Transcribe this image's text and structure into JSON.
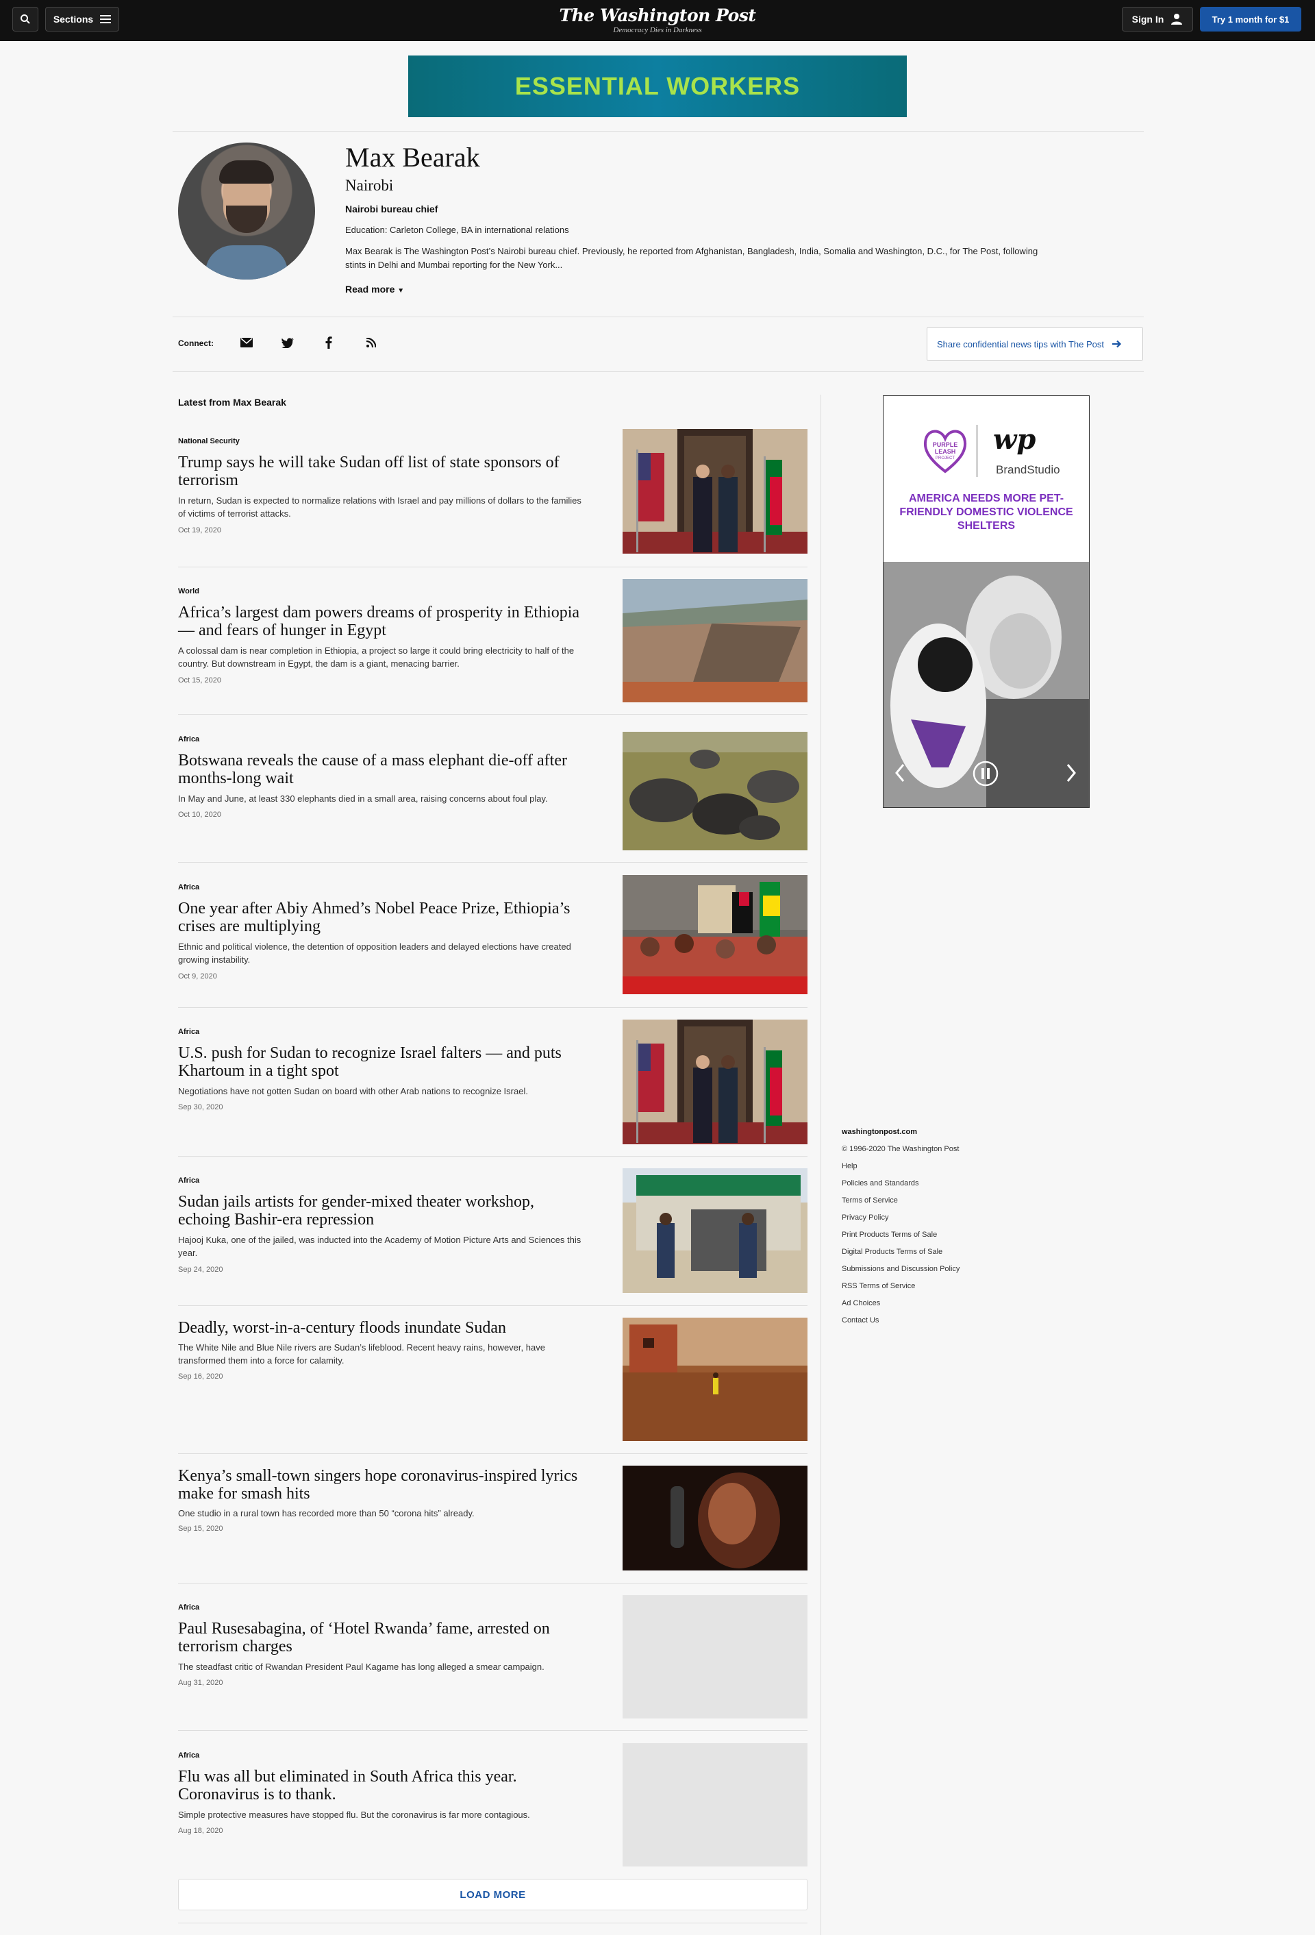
{
  "nav": {
    "sections_label": "Sections",
    "logo": "The Washington Post",
    "tagline": "Democracy Dies in Darkness",
    "signin_label": "Sign In",
    "subscribe_label": "Try 1 month for $1"
  },
  "top_ad": {
    "text": "ESSENTIAL WORKERS"
  },
  "author": {
    "name": "Max Bearak",
    "location": "Nairobi",
    "title": "Nairobi bureau chief",
    "education": "Education: Carleton College, BA in international relations",
    "bio": "Max Bearak is The Washington Post’s Nairobi bureau chief. Previously, he reported from Afghanistan, Bangladesh, India, Somalia and Washington, D.C., for The Post, following stints in Delhi and Mumbai reporting for the New York...",
    "read_more": "Read more"
  },
  "connect": {
    "label": "Connect:",
    "icons": [
      "email-icon",
      "twitter-icon",
      "facebook-icon",
      "rss-icon"
    ],
    "tips_label": "Share confidential news tips with The Post"
  },
  "latest_label": "Latest from Max Bearak",
  "articles": [
    {
      "kicker": "National Security",
      "headline": "Trump says he will take Sudan off list of state sponsors of terrorism",
      "blurb": "In return, Sudan is expected to normalize relations with Israel and pay millions of dollars to the families of victims of terrorist attacks.",
      "date": "Oct 19, 2020"
    },
    {
      "kicker": "World",
      "headline": "Africa’s largest dam powers dreams of prosperity in Ethiopia — and fears of hunger in Egypt",
      "blurb": "A colossal dam is near completion in Ethiopia, a project so large it could bring electricity to half of the country. But downstream in Egypt, the dam is a giant, menacing barrier.",
      "date": "Oct 15, 2020"
    },
    {
      "kicker": "Africa",
      "headline": "Botswana reveals the cause of a mass elephant die-off after months-long wait",
      "blurb": "In May and June, at least 330 elephants died in a small area, raising concerns about foul play.",
      "date": "Oct 10, 2020"
    },
    {
      "kicker": "Africa",
      "headline": "One year after Abiy Ahmed’s Nobel Peace Prize, Ethiopia’s crises are multiplying",
      "blurb": "Ethnic and political violence, the detention of opposition leaders and delayed elections have created growing instability.",
      "date": "Oct 9, 2020"
    },
    {
      "kicker": "Africa",
      "headline": "U.S. push for Sudan to recognize Israel falters — and puts Khartoum in a tight spot",
      "blurb": "Negotiations have not gotten Sudan on board with other Arab nations to recognize Israel.",
      "date": "Sep 30, 2020"
    },
    {
      "kicker": "Africa",
      "headline": "Sudan jails artists for gender-mixed theater workshop, echoing Bashir-era repression",
      "blurb": "Hajooj Kuka, one of the jailed, was inducted into the Academy of Motion Picture Arts and Sciences this year.",
      "date": "Sep 24, 2020"
    },
    {
      "kicker": "",
      "headline": "Deadly, worst-in-a-century floods inundate Sudan",
      "blurb": "The White Nile and Blue Nile rivers are Sudan’s lifeblood. Recent heavy rains, however, have transformed them into a force for calamity.",
      "date": "Sep 16, 2020"
    },
    {
      "kicker": "",
      "headline": "Kenya’s small-town singers hope coronavirus-inspired lyrics make for smash hits",
      "blurb": "One studio in a rural town has recorded more than 50 “corona hits” already.",
      "date": "Sep 15, 2020"
    },
    {
      "kicker": "Africa",
      "headline": "Paul Rusesabagina, of ‘Hotel Rwanda’ fame, arrested on terrorism charges",
      "blurb": "The steadfast critic of Rwandan President Paul Kagame has long alleged a smear campaign.",
      "date": "Aug 31, 2020"
    },
    {
      "kicker": "Africa",
      "headline": "Flu was all but eliminated in South Africa this year. Coronavirus is to thank.",
      "blurb": "Simple protective measures have stopped flu. But the coronavirus is far more contagious.",
      "date": "Aug 18, 2020"
    }
  ],
  "load_more": "LOAD MORE",
  "side_ad": {
    "brand": "BrandStudio",
    "headline": "AMERICA NEEDS MORE PET-FRIENDLY DOMESTIC VIOLENCE SHELTERS",
    "wp_mark": "wp",
    "partner_logo_text": "PURPLE LEASH PROJECT"
  },
  "footer": {
    "domain": "washingtonpost.com",
    "copyright": "© 1996-2020 The Washington Post",
    "links": [
      "Help",
      "Policies and Standards",
      "Terms of Service",
      "Privacy Policy",
      "Print Products Terms of Sale",
      "Digital Products Terms of Sale",
      "Submissions and Discussion Policy",
      "RSS Terms of Service",
      "Ad Choices",
      "Contact Us"
    ]
  }
}
